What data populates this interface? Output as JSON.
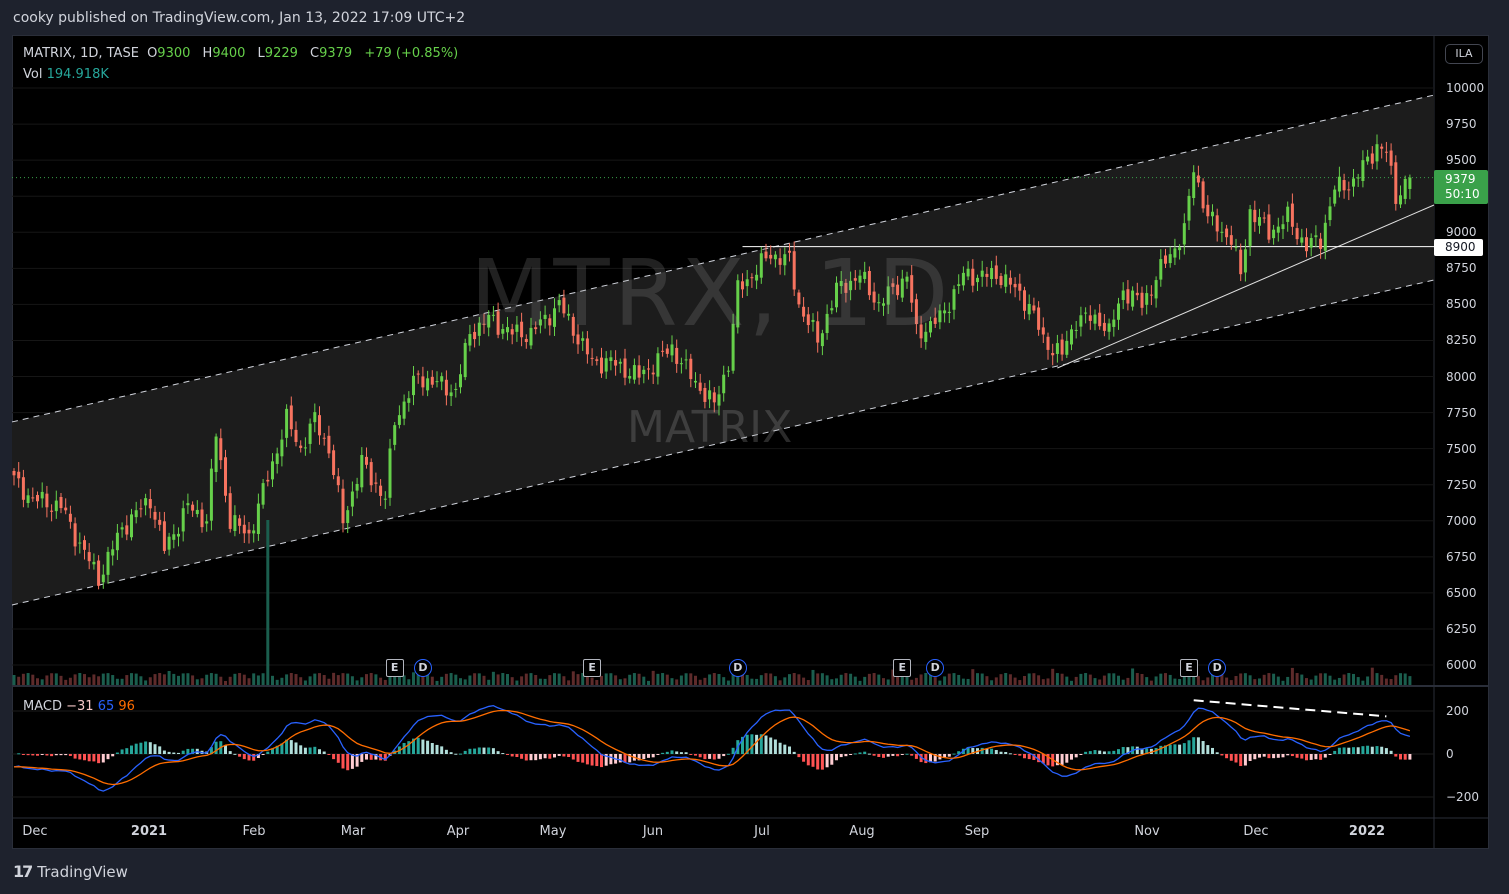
{
  "header": {
    "published": "cooky published on TradingView.com, Jan 13, 2022 17:09 UTC+2"
  },
  "legend": {
    "symbol": "MATRIX, 1D, TASE",
    "open_label": "O",
    "open": "9300",
    "high_label": "H",
    "high": "9400",
    "low_label": "L",
    "low": "9229",
    "close_label": "C",
    "close": "9379",
    "change": "+79 (+0.85%)",
    "vol_label": "Vol",
    "vol": "194.918K"
  },
  "watermark": {
    "title": "MTRX, 1D",
    "subtitle": "MATRIX"
  },
  "price_axis": {
    "currency": "ILA",
    "ticks": [
      10000,
      9750,
      9500,
      9250,
      9000,
      8750,
      8500,
      8250,
      8000,
      7750,
      7500,
      7250,
      7000,
      6750,
      6500,
      6250,
      6000
    ],
    "current_price": "9379",
    "countdown": "50:10",
    "level_label": "8900"
  },
  "macd": {
    "label": "MACD",
    "hist": "−31",
    "macd": "65",
    "signal": "96",
    "ticks": [
      "200",
      "0",
      "−200"
    ]
  },
  "time_axis": {
    "labels": [
      "Dec",
      "2021",
      "Feb",
      "Mar",
      "Apr",
      "May",
      "Jun",
      "Jul",
      "Aug",
      "Sep",
      "Nov",
      "Dec",
      "2022"
    ]
  },
  "events": {
    "e": "E",
    "d": "D"
  },
  "footer": {
    "brand": "TradingView",
    "logo": "17"
  },
  "colors": {
    "up": "#66d04a",
    "down": "#f7735f",
    "macd": "#2962ff",
    "signal": "#ff6d00",
    "bg": "#000000",
    "page": "#1e222d"
  },
  "chart_data": {
    "type": "candlestick",
    "title": "MATRIX, 1D, TASE",
    "ylim": [
      6000,
      10000
    ],
    "ylabel": "ILA",
    "bars": 298,
    "close_keypoints_bar_price": [
      [
        0,
        7280
      ],
      [
        4,
        7150
      ],
      [
        10,
        7100
      ],
      [
        13,
        6900
      ],
      [
        18,
        6600
      ],
      [
        23,
        6950
      ],
      [
        29,
        7150
      ],
      [
        32,
        6800
      ],
      [
        37,
        7100
      ],
      [
        41,
        7000
      ],
      [
        43,
        7600
      ],
      [
        46,
        7000
      ],
      [
        50,
        6900
      ],
      [
        54,
        7300
      ],
      [
        58,
        7700
      ],
      [
        61,
        7500
      ],
      [
        64,
        7700
      ],
      [
        67,
        7500
      ],
      [
        70,
        7000
      ],
      [
        74,
        7400
      ],
      [
        79,
        7150
      ],
      [
        81,
        7700
      ],
      [
        86,
        8000
      ],
      [
        94,
        7900
      ],
      [
        97,
        8300
      ],
      [
        101,
        8400
      ],
      [
        106,
        8300
      ],
      [
        110,
        8300
      ],
      [
        116,
        8500
      ],
      [
        123,
        8100
      ],
      [
        127,
        8100
      ],
      [
        133,
        8000
      ],
      [
        140,
        8200
      ],
      [
        144,
        8000
      ],
      [
        149,
        7800
      ],
      [
        152,
        8100
      ],
      [
        154,
        8600
      ],
      [
        161,
        8850
      ],
      [
        165,
        8800
      ],
      [
        167,
        8500
      ],
      [
        171,
        8250
      ],
      [
        175,
        8600
      ],
      [
        180,
        8700
      ],
      [
        184,
        8500
      ],
      [
        190,
        8700
      ],
      [
        192,
        8300
      ],
      [
        197,
        8400
      ],
      [
        202,
        8700
      ],
      [
        210,
        8700
      ],
      [
        216,
        8500
      ],
      [
        219,
        8250
      ],
      [
        223,
        8150
      ],
      [
        226,
        8400
      ],
      [
        231,
        8400
      ],
      [
        233,
        8300
      ],
      [
        236,
        8600
      ],
      [
        240,
        8500
      ],
      [
        245,
        8800
      ],
      [
        249,
        9000
      ],
      [
        251,
        9450
      ],
      [
        254,
        9100
      ],
      [
        259,
        8950
      ],
      [
        261,
        8700
      ],
      [
        263,
        9150
      ],
      [
        267,
        9000
      ],
      [
        271,
        9100
      ],
      [
        275,
        8900
      ],
      [
        278,
        8950
      ],
      [
        281,
        9300
      ],
      [
        285,
        9350
      ],
      [
        290,
        9600
      ],
      [
        292,
        9550
      ],
      [
        294,
        9250
      ],
      [
        297,
        9379
      ]
    ],
    "last_bar": {
      "open": 9300,
      "high": 9400,
      "low": 9229,
      "close": 9379,
      "volume": "194.918K"
    },
    "drawings": {
      "channel_upper": [
        [
          0,
          7685
        ],
        [
          302,
          9951
        ]
      ],
      "channel_lower": [
        [
          0,
          6416
        ],
        [
          302,
          8669
        ]
      ],
      "trendline": [
        [
          222,
          8059
        ],
        [
          302,
          9189
        ]
      ],
      "horizontal_level": {
        "price": 8900,
        "from_bar": 155
      },
      "macd_divergence": [
        [
          251,
          250
        ],
        [
          292,
          175
        ]
      ]
    },
    "event_bars": {
      "E": [
        81,
        123,
        189,
        250
      ],
      "D": [
        87,
        154,
        196,
        256
      ]
    },
    "indicator": {
      "name": "MACD",
      "fast": 12,
      "slow": 26,
      "signal": 9,
      "ylim": [
        -280,
        280
      ]
    }
  }
}
